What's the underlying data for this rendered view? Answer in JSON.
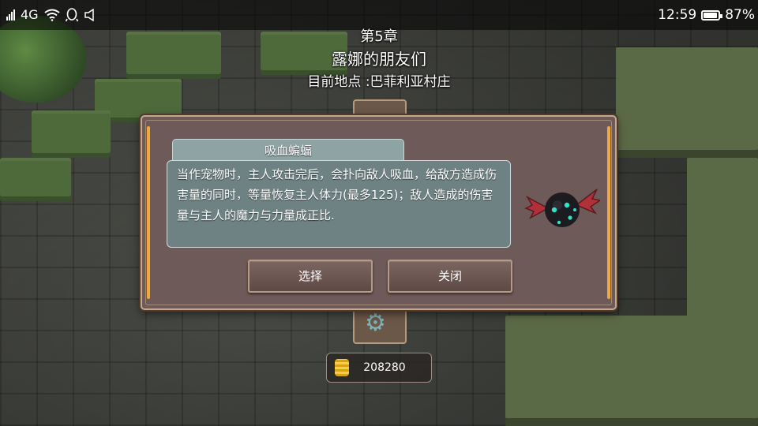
{
  "status_bar": {
    "network": "4G",
    "time": "12:59",
    "battery_percent": "87%",
    "battery_level": 0.87,
    "icons": [
      "signal-icon",
      "wifi-icon",
      "qq-icon",
      "mute-icon",
      "battery-icon"
    ]
  },
  "chapter": {
    "number": "第5章",
    "title": "露娜的朋友们",
    "location": "目前地点 :巴菲利亚村庄"
  },
  "pet_dialog": {
    "name": "吸血蝙蝠",
    "description": "当作宠物时，主人攻击完后，会扑向敌人吸血，给敌方造成伤害量的同时，等量恢复主人体力(最多125)；敌人造成的伤害量与主人的魔力与力量成正比.",
    "select_label": "选择",
    "close_label": "关闭"
  },
  "currency": {
    "gold": "208280",
    "icon": "gold-coin-icon"
  },
  "colors": {
    "dialog_bg": "#6e5a58",
    "dialog_border": "#c8a886",
    "accent_bar": "#f2a93b",
    "text_panel": "#6f8283"
  }
}
